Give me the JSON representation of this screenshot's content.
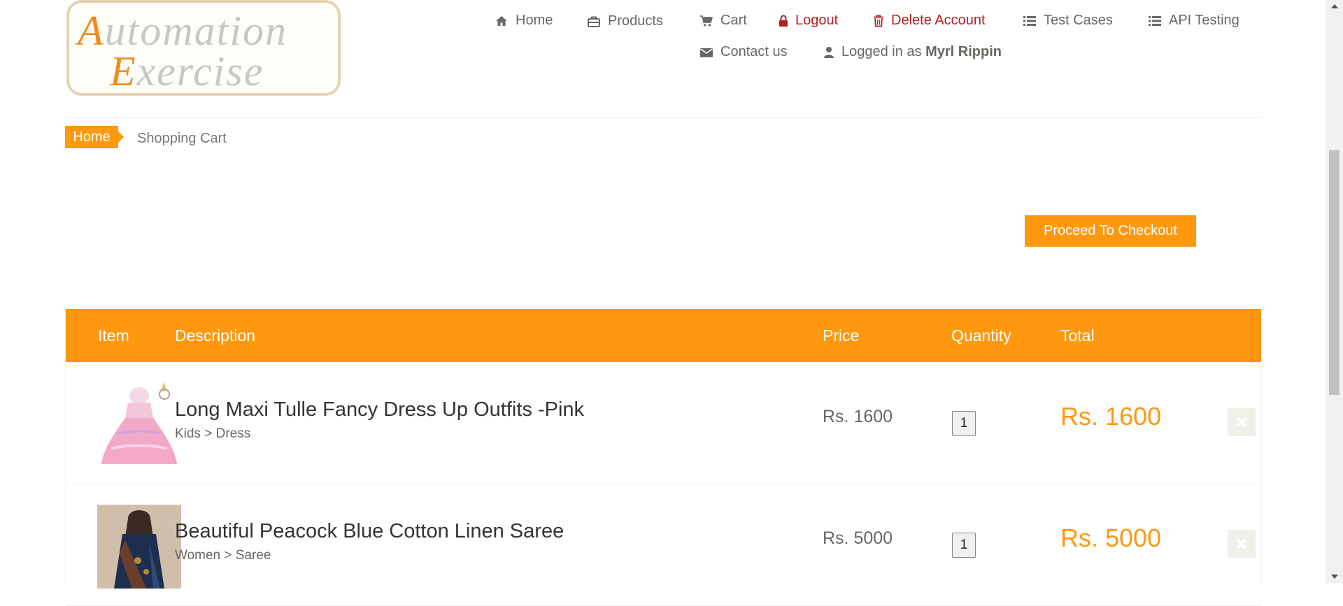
{
  "logo": {
    "line1_cap": "A",
    "line1_rest": "utomation",
    "line2_cap": "E",
    "line2_rest": "xercise"
  },
  "nav": {
    "home": "Home",
    "products": "Products",
    "cart": "Cart",
    "logout": "Logout",
    "delete_account": "Delete Account",
    "test_cases": "Test Cases",
    "api_testing": "API Testing",
    "contact_us": "Contact us",
    "logged_in_prefix": "Logged in as",
    "user_name": "Myrl Rippin"
  },
  "breadcrumb": {
    "home": "Home",
    "current": "Shopping Cart"
  },
  "checkout": {
    "label": "Proceed To Checkout"
  },
  "table": {
    "headers": {
      "item": "Item",
      "description": "Description",
      "price": "Price",
      "quantity": "Quantity",
      "total": "Total"
    },
    "rows": [
      {
        "name": "Long Maxi Tulle Fancy Dress Up Outfits -Pink",
        "category": "Kids > Dress",
        "price": "Rs. 1600",
        "quantity": "1",
        "total": "Rs. 1600"
      },
      {
        "name": "Beautiful Peacock Blue Cotton Linen Saree",
        "category": "Women > Saree",
        "price": "Rs. 5000",
        "quantity": "1",
        "total": "Rs. 5000"
      }
    ]
  },
  "colors": {
    "accent": "#fe980f",
    "danger": "#b22222"
  },
  "icons": [
    "home-icon",
    "briefcase-icon",
    "cart-icon",
    "lock-icon",
    "trash-icon",
    "list-icon",
    "envelope-icon",
    "user-icon",
    "close-icon"
  ]
}
